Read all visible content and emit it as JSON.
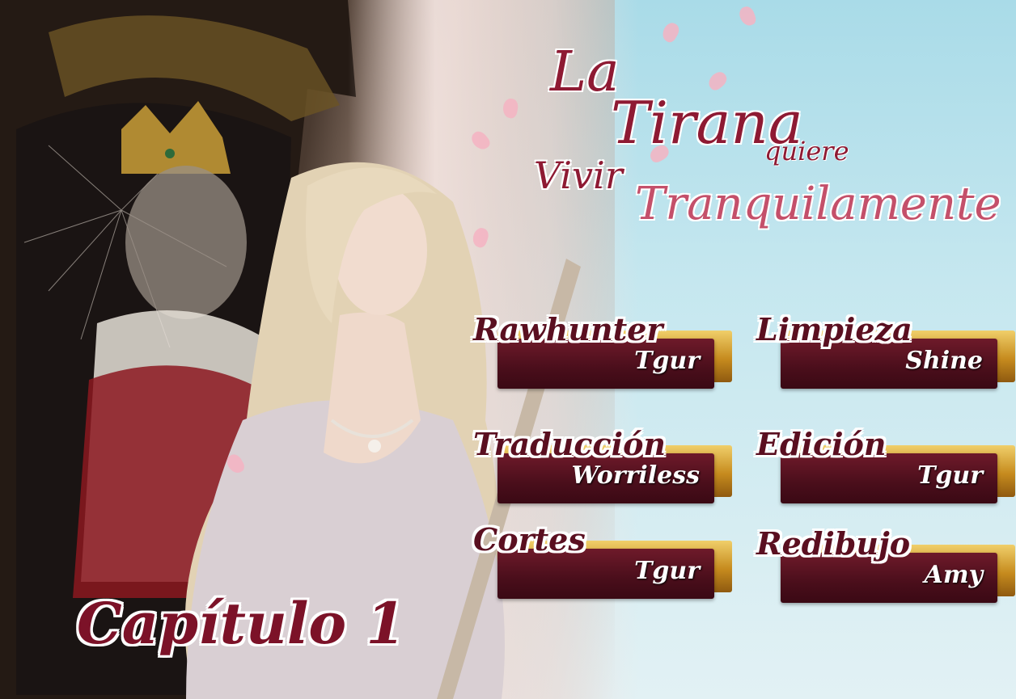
{
  "title": {
    "line1": "La",
    "line2": "Tirana",
    "line3_small": "quiere",
    "line4": "Vivir",
    "line5": "Tranquilamente"
  },
  "credits": [
    {
      "role": "Rawhunter",
      "name": "Tgur"
    },
    {
      "role": "Limpieza",
      "name": "Shine"
    },
    {
      "role": "Traducción",
      "name": "Worriless"
    },
    {
      "role": "Edición",
      "name": "Tgur"
    },
    {
      "role": "Cortes",
      "name": "Tgur"
    },
    {
      "role": "Redibujo",
      "name": "Amy"
    }
  ],
  "chapter": "Capítulo 1",
  "colors": {
    "title": "#8e1a33",
    "title_accent": "#c4506a",
    "bar": "#4a0e1b",
    "gold": "#c68b1e",
    "sky": "#a9dbe8"
  }
}
